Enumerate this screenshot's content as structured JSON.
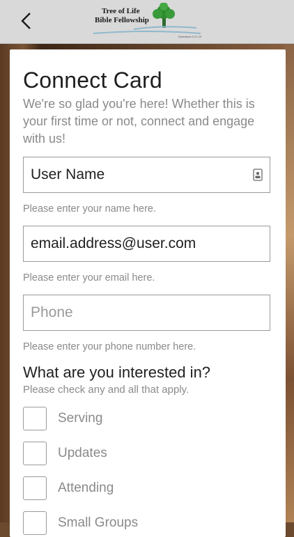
{
  "header": {
    "back_icon": "chevron-left-icon",
    "logo": {
      "line1": "Tree of Life",
      "line2": "Bible Fellowship",
      "tagline": "Ephesians 3:17-19"
    }
  },
  "form": {
    "title": "Connect Card",
    "intro": "We're so glad you're here! Whether this is your first time or not, connect and engage with us!",
    "name_field": {
      "value": "User Name",
      "help": "Please enter your name here.",
      "icon": "contact-card-icon"
    },
    "email_field": {
      "value": "email.address@user.com",
      "help": "Please enter your email here."
    },
    "phone_field": {
      "value": "",
      "placeholder": "Phone",
      "help": "Please enter your phone number here."
    },
    "interest": {
      "question": "What are you interested in?",
      "subtitle": "Please check any and all that apply.",
      "options": [
        "Serving",
        "Updates",
        "Attending",
        "Small Groups"
      ]
    }
  },
  "colors": {
    "topbar": "#d9d9d9",
    "card": "#ffffff",
    "text": "#1f1f1f",
    "muted": "#8a8a8a",
    "logo_green": "#2e8b2e"
  }
}
